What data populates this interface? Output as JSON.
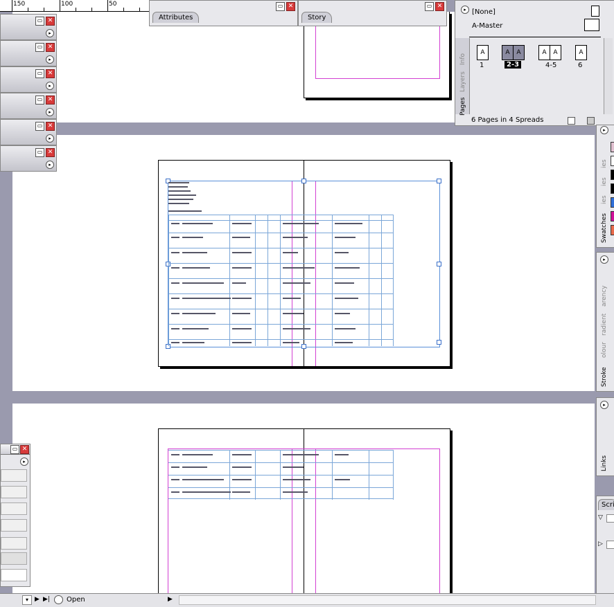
{
  "ruler": {
    "labels": [
      "150",
      "100",
      "50"
    ]
  },
  "panels": {
    "attributes": {
      "tab": "Attributes"
    },
    "story": {
      "tab": "Story"
    },
    "pages": {
      "tabs": [
        "Info",
        "Layers",
        "Pages"
      ],
      "master_none": "[None]",
      "master_a": "A-Master",
      "page_labels": [
        "1",
        "2-3",
        "4-5",
        "6"
      ],
      "thumb_letter": "A",
      "footer": "6 Pages in 4 Spreads"
    },
    "swatches": {
      "tabs": [
        "ies",
        "ies",
        "ies",
        "Swatches"
      ],
      "colors": [
        "#e0c0d0",
        "#ffffff",
        "#000000",
        "#000000",
        "#2f6fd8",
        "#d0109a",
        "#e86a4a"
      ]
    },
    "stroke": {
      "tabs": [
        "arency",
        "radient",
        "olour",
        "Stroke"
      ]
    },
    "links": {
      "tab": "Links"
    },
    "scripts": {
      "tab": "Scri"
    }
  },
  "statusbar": {
    "status_text": "Open"
  },
  "colors": {
    "accent_margin": "#d23fd2",
    "frame_blue": "#5a8fd8",
    "close_red": "#d83a3a",
    "pasteboard_gray": "#9a9aae"
  }
}
